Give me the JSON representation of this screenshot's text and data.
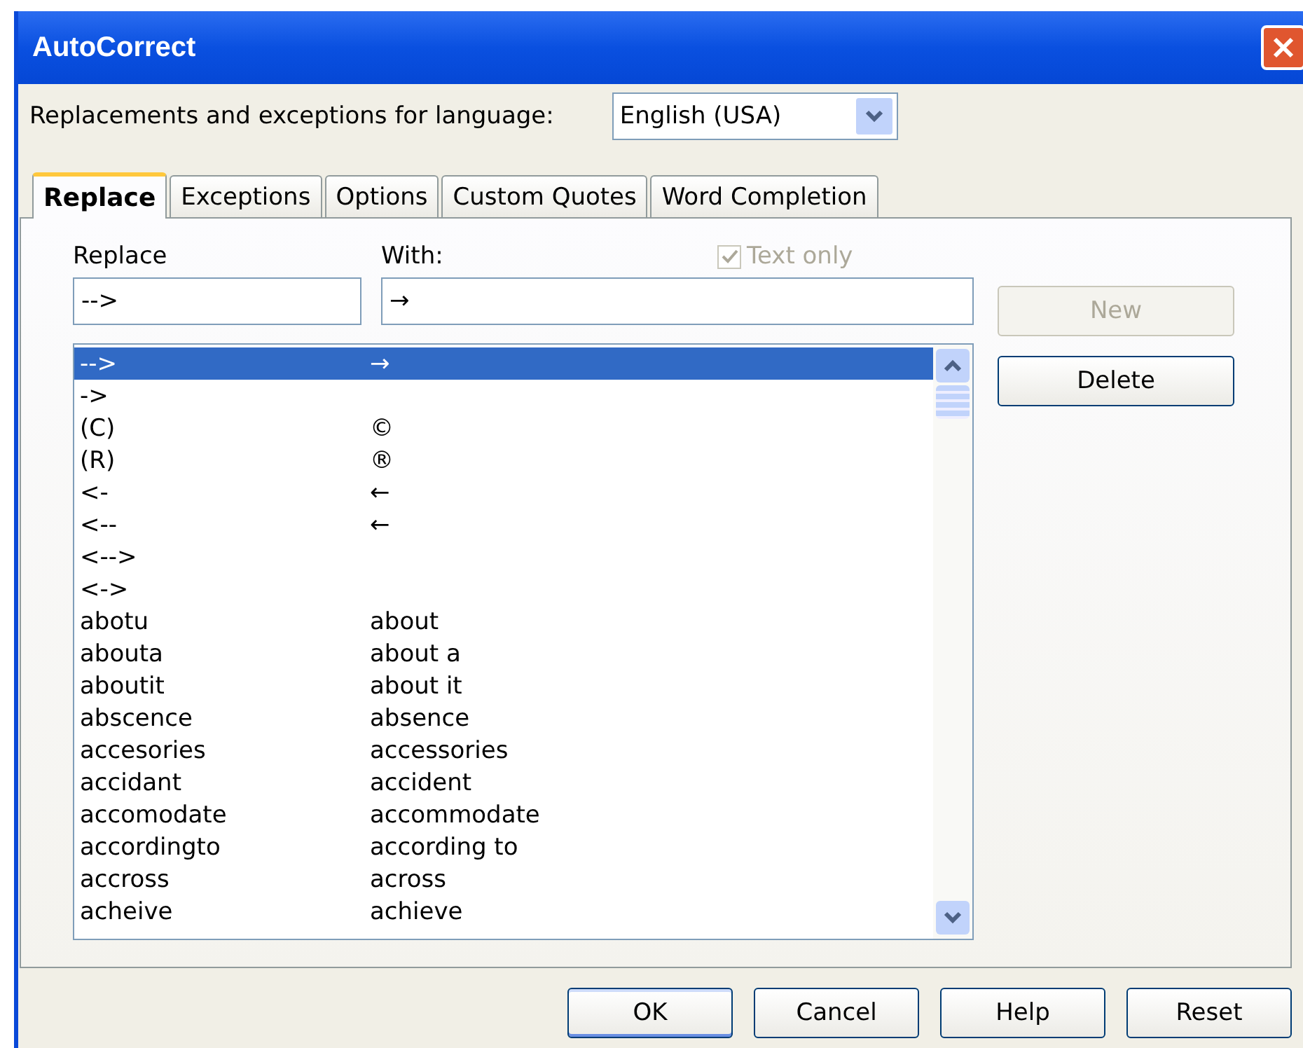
{
  "window": {
    "title": "AutoCorrect"
  },
  "language": {
    "label": "Replacements and exceptions for language:",
    "value": "English (USA)"
  },
  "tabs": [
    {
      "label": "Replace",
      "selected": true
    },
    {
      "label": "Exceptions",
      "selected": false
    },
    {
      "label": "Options",
      "selected": false
    },
    {
      "label": "Custom Quotes",
      "selected": false
    },
    {
      "label": "Word Completion",
      "selected": false
    }
  ],
  "replace_field": {
    "label": "Replace",
    "value": "-->"
  },
  "with_field": {
    "label": "With:",
    "value": "→"
  },
  "text_only": {
    "label": "Text only",
    "checked": true,
    "disabled": true
  },
  "side_buttons": [
    {
      "label": "New",
      "disabled": true
    },
    {
      "label": "Delete",
      "disabled": false
    }
  ],
  "entries": [
    {
      "replace": "-->",
      "with": "→",
      "selected": true
    },
    {
      "replace": "->",
      "selected": false
    },
    {
      "replace": "(C)",
      "with": "©",
      "selected": false
    },
    {
      "replace": "(R)",
      "with": "®",
      "selected": false
    },
    {
      "replace": "<-",
      "with": "←",
      "selected": false
    },
    {
      "replace": "<--",
      "with": "←",
      "selected": false
    },
    {
      "replace": "<-->",
      "selected": false
    },
    {
      "replace": "<->",
      "selected": false
    },
    {
      "replace": "abotu",
      "with": "about",
      "selected": false
    },
    {
      "replace": "abouta",
      "with": "about a",
      "selected": false
    },
    {
      "replace": "aboutit",
      "with": "about it",
      "selected": false
    },
    {
      "replace": "abscence",
      "with": "absence",
      "selected": false
    },
    {
      "replace": "accesories",
      "with": "accessories",
      "selected": false
    },
    {
      "replace": "accidant",
      "with": "accident",
      "selected": false
    },
    {
      "replace": "accomodate",
      "with": "accommodate",
      "selected": false
    },
    {
      "replace": "accordingto",
      "with": "according to",
      "selected": false
    },
    {
      "replace": "accross",
      "with": "across",
      "selected": false
    },
    {
      "replace": "acheive",
      "with": "achieve",
      "selected": false
    }
  ],
  "buttons": [
    {
      "label": "OK",
      "kind": "default"
    },
    {
      "label": "Cancel",
      "kind": "normal"
    },
    {
      "label": "Help",
      "kind": "normal"
    },
    {
      "label": "Reset",
      "kind": "normal"
    }
  ]
}
